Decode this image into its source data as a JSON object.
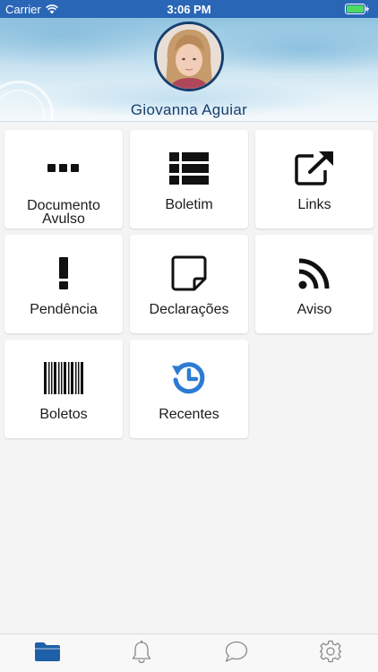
{
  "status_bar": {
    "carrier": "Carrier",
    "time": "3:06 PM"
  },
  "header": {
    "student_name": "Giovanna Aguiar"
  },
  "tiles": [
    {
      "label": "Documento Avulso",
      "icon": "ellipsis-icon"
    },
    {
      "label": "Boletim",
      "icon": "list-icon"
    },
    {
      "label": "Links",
      "icon": "external-link-icon"
    },
    {
      "label": "Pendência",
      "icon": "exclamation-icon"
    },
    {
      "label": "Declarações",
      "icon": "note-icon"
    },
    {
      "label": "Aviso",
      "icon": "rss-icon"
    },
    {
      "label": "Boletos",
      "icon": "barcode-icon"
    },
    {
      "label": "Recentes",
      "icon": "history-icon"
    }
  ],
  "tabbar": {
    "tabs": [
      {
        "icon": "folder-icon",
        "active": true
      },
      {
        "icon": "bell-icon",
        "active": false
      },
      {
        "icon": "chat-icon",
        "active": false
      },
      {
        "icon": "gear-icon",
        "active": false
      }
    ]
  },
  "colors": {
    "accent": "#1f5fa8",
    "brand_dark": "#173f6d",
    "recentes_icon": "#2d7bd3",
    "status_bar": "#2a66b6",
    "battery": "#4cd964"
  }
}
